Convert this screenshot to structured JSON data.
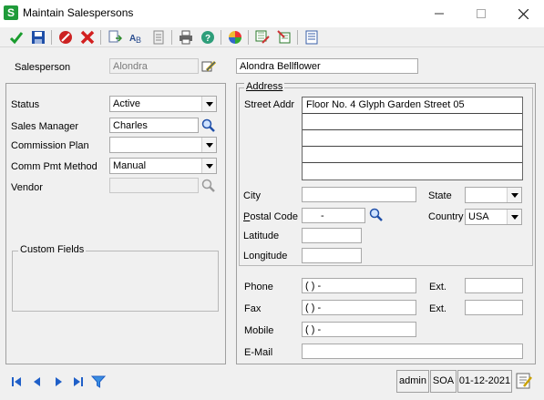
{
  "window": {
    "title": "Maintain Salespersons",
    "app_icon_letter": "S"
  },
  "toolbar": {
    "icons": [
      "accept-icon",
      "save-icon",
      "cancel-icon",
      "delete-icon",
      "copy-icon",
      "rename-icon",
      "memo-icon",
      "print-icon",
      "help-icon",
      "color-icon",
      "export-icon",
      "import-icon",
      "settings-icon"
    ]
  },
  "header": {
    "salesperson_label": "Salesperson",
    "salesperson_code": "Alondra",
    "salesperson_name": "Alondra Bellflower"
  },
  "left": {
    "status_label": "Status",
    "status_value": "Active",
    "sales_manager_label": "Sales Manager",
    "sales_manager_value": "Charles",
    "commission_plan_label": "Commission Plan",
    "commission_plan_value": "",
    "comm_pmt_method_label": "Comm Pmt Method",
    "comm_pmt_method_value": "Manual",
    "vendor_label": "Vendor",
    "vendor_value": "",
    "custom_fields_label": "Custom Fields"
  },
  "address": {
    "group_label": "Address",
    "street_label": "Street Addr",
    "street_lines": [
      "Floor No. 4 Glyph Garden Street 05",
      "",
      "",
      "",
      ""
    ],
    "city_label": "City",
    "city_value": "",
    "state_label": "State",
    "state_value": "",
    "postal_code_label": "Postal Code",
    "postal_code_value": "-",
    "country_label": "Country",
    "country_value": "USA",
    "latitude_label": "Latitude",
    "latitude_value": "",
    "longitude_label": "Longitude",
    "longitude_value": ""
  },
  "contact": {
    "phone_label": "Phone",
    "phone_value": "(   )    -",
    "phone_ext_label": "Ext.",
    "phone_ext_value": "",
    "fax_label": "Fax",
    "fax_value": "(   )    -",
    "fax_ext_label": "Ext.",
    "fax_ext_value": "",
    "mobile_label": "Mobile",
    "mobile_value": "(   )    -",
    "email_label": "E-Mail",
    "email_value": ""
  },
  "statusbar": {
    "user": "admin",
    "company": "SOA",
    "date": "01-12-2021"
  },
  "colors": {
    "accept": "#1a9c2e",
    "save": "#1f4fa8",
    "cancel": "#cc2222",
    "title_bar": "#ffffff"
  }
}
